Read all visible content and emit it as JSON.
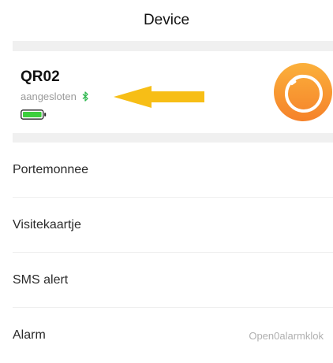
{
  "header": {
    "title": "Device"
  },
  "device": {
    "name": "QR02",
    "status": "aangesloten",
    "icons": [
      "bluetooth-icon",
      "battery-icon",
      "arrow-left-icon",
      "watch-icon"
    ],
    "colors": {
      "battery": "#3ccf3c",
      "bluetooth": "#2fb84f",
      "arrow": "#f7be16",
      "watch": "#f6982e"
    }
  },
  "menu": {
    "items": [
      {
        "label": "Portemonnee",
        "value": ""
      },
      {
        "label": "Visitekaartje",
        "value": ""
      },
      {
        "label": "SMS alert",
        "value": ""
      },
      {
        "label": "Alarm",
        "value": "Open0alarmklok"
      }
    ]
  }
}
